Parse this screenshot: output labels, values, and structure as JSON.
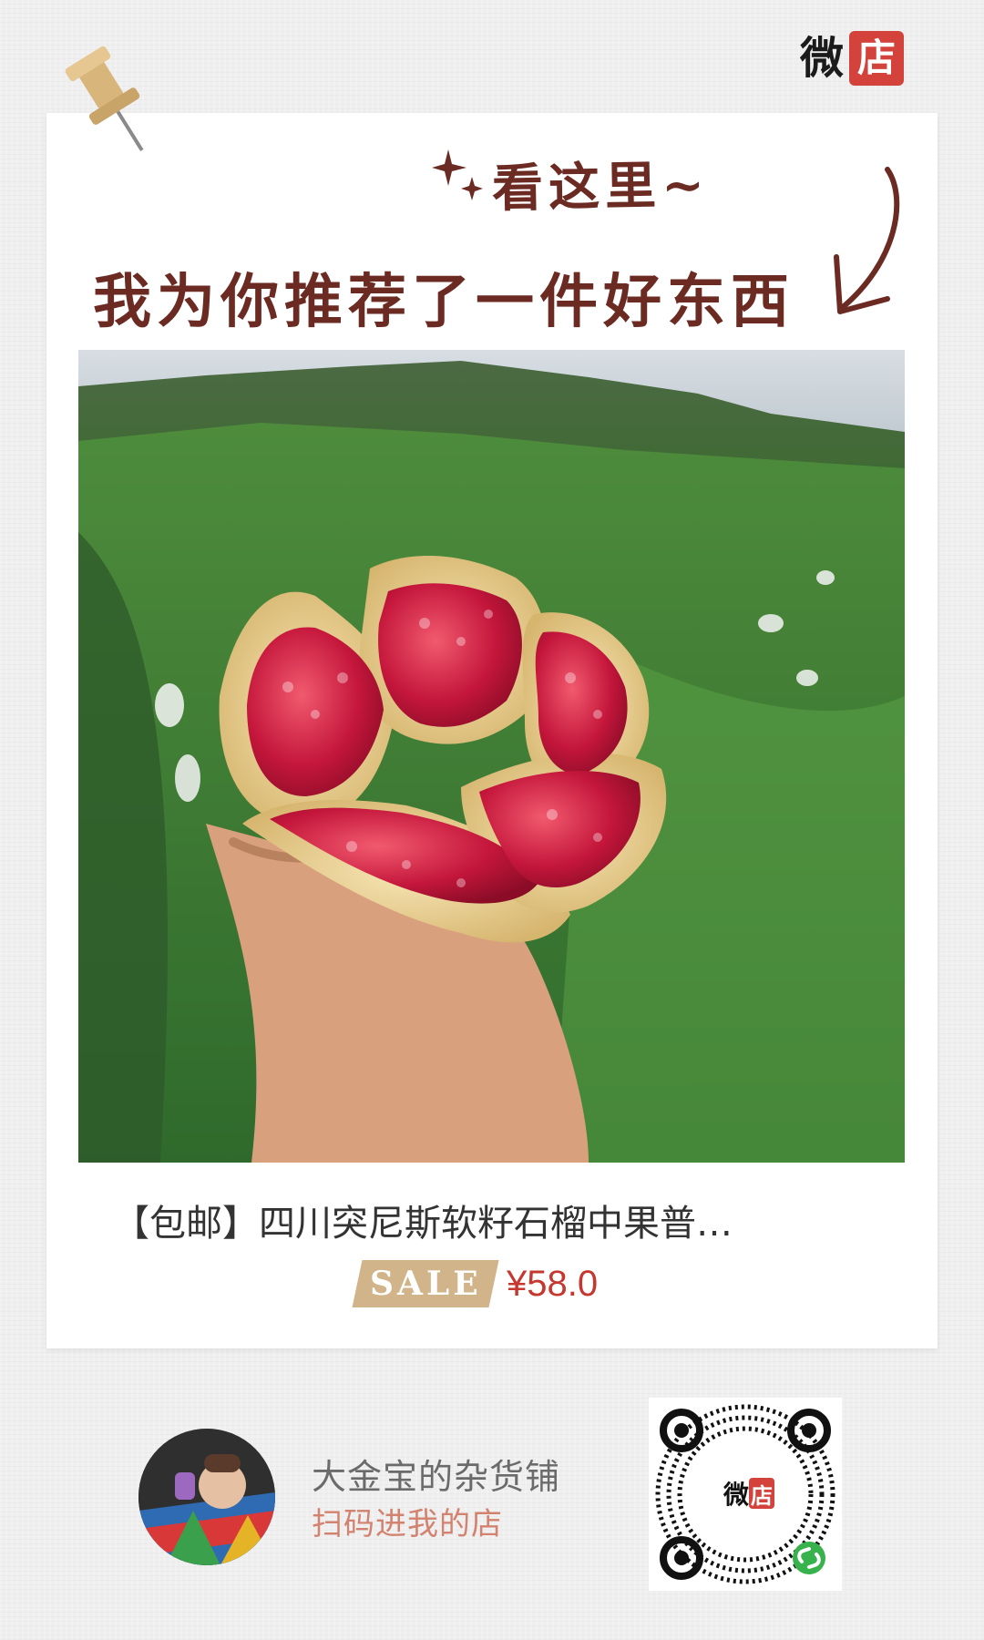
{
  "brand": {
    "wei": "微",
    "dian": "店"
  },
  "headline": {
    "line1": "看这里~",
    "line2": "我为你推荐了一件好东西"
  },
  "product": {
    "title": "【包邮】四川突尼斯软籽石榴中果普…",
    "sale_badge": "SALE",
    "price": "¥58.0"
  },
  "shop": {
    "name": "大金宝的杂货铺",
    "cta": "扫码进我的店"
  },
  "qr": {
    "wei": "微",
    "dian": "店"
  },
  "colors": {
    "accent_red": "#d3423b",
    "headline_brown": "#6b2a22",
    "sale_tan": "#d2b48a",
    "price_red": "#c6382f",
    "cta_salmon": "#d2826e"
  },
  "icons": [
    "pushpin-icon",
    "sparkle-icon",
    "curved-arrow-icon",
    "mini-program-link-icon"
  ]
}
